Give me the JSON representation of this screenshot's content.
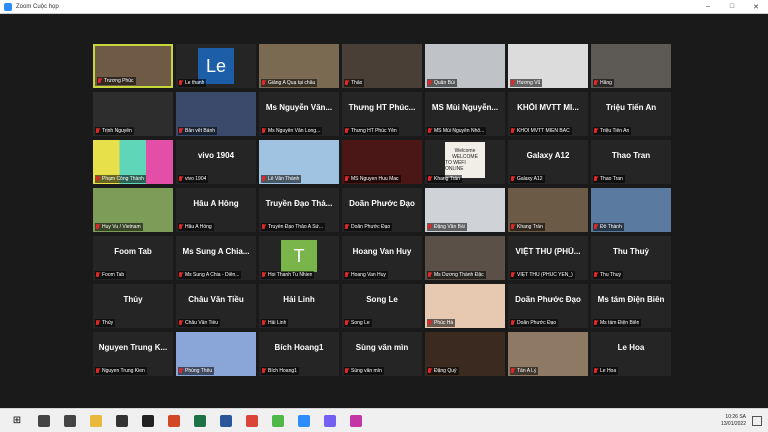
{
  "window": {
    "title": "Zoom Cuộc họp",
    "brand_color": "#2d8cff",
    "controls": [
      "minimize-icon",
      "maximize-icon",
      "close-icon"
    ]
  },
  "participants": [
    {
      "label": "Trương Phúc",
      "type": "video",
      "bg": "#6e5a45",
      "active": true
    },
    {
      "label": "Le thanh",
      "type": "avatar-le",
      "bg": "#ffffff"
    },
    {
      "label": "Giảng A Quạ tại châu",
      "type": "video",
      "bg": "#7a6a52"
    },
    {
      "label": "Thảo",
      "type": "video",
      "bg": "#4a3f36"
    },
    {
      "label": "Quân Bùi",
      "type": "video",
      "bg": "#bfc2c6"
    },
    {
      "label": "Hương Vũ",
      "type": "video",
      "bg": "#dcdcdc"
    },
    {
      "label": "Hằng",
      "type": "video",
      "bg": "#5d5a55"
    },
    {
      "label": "Trịnh Nguyễn",
      "type": "video",
      "bg": "#2d2d2d"
    },
    {
      "label": "Bản vẽt Bánh",
      "type": "video",
      "bg": "#3b4a6a"
    },
    {
      "name": "Ms Nguyễn Văn...",
      "label": "Ms Nguyễn Văn Long...",
      "type": "name"
    },
    {
      "name": "Thưng HT Phúc...",
      "label": "Thưng HT Phúc Yên",
      "type": "name"
    },
    {
      "name": "MS Mùi Nguyễn...",
      "label": "MS Mùi Nguyễn Nhô...",
      "type": "name"
    },
    {
      "name": "KHỐI MVTT MI...",
      "label": "KHỐI MVTT MIỀN BẮC",
      "type": "name"
    },
    {
      "name": "Triệu Tiến An",
      "label": "Triệu Tiến An",
      "type": "name"
    },
    {
      "label": "Phạm Công Thành",
      "type": "colors",
      "bg": "#e7e04a"
    },
    {
      "name": "vivo 1904",
      "label": "vivo 1904",
      "type": "name"
    },
    {
      "label": "Lê Văn Thành",
      "type": "video",
      "bg": "#9fc3e0"
    },
    {
      "label": "MS Nguyen Huu Mac",
      "type": "video",
      "bg": "#4a1616"
    },
    {
      "label": "Khang Trần",
      "type": "welcome",
      "bg": "#2a2a2a",
      "welcome_lines": [
        "Welcome",
        "WELCOME",
        "TO WEFI ONLINE"
      ]
    },
    {
      "name": "Galaxy A12",
      "label": "Galaxy A12",
      "type": "name"
    },
    {
      "name": "Thao Tran",
      "label": "Thao Tran",
      "type": "name"
    },
    {
      "label": "Huy Vu / Vietnam",
      "type": "video",
      "bg": "#7c9c58"
    },
    {
      "name": "Hâu A Hông",
      "label": "Hâu A Hồng",
      "type": "name"
    },
    {
      "name": "Truyền Đạo Thả...",
      "label": "Truyền Đạo Thảo A Sử...",
      "type": "name"
    },
    {
      "name": "Doãn Phước Đạo",
      "label": "Doãn Phước Đạo",
      "type": "name"
    },
    {
      "label": "Đặng Văn Bái",
      "type": "video",
      "bg": "#cfd3d8"
    },
    {
      "label": "Khang Trần",
      "type": "video",
      "bg": "#6a5a46"
    },
    {
      "label": "Đỗ Thành",
      "type": "video",
      "bg": "#5a7aa0"
    },
    {
      "name": "Foom Tab",
      "label": "Foom Tab",
      "type": "name"
    },
    {
      "name": "Ms Sung A Chia...",
      "label": "Ms Sung A Chia - Diên...",
      "type": "name"
    },
    {
      "label": "Hoi Thanh Tu Nhien",
      "type": "avatar-t",
      "bg": "#252525"
    },
    {
      "name": "Hoang Van Huy",
      "label": "Hoang Van Huy",
      "type": "name"
    },
    {
      "label": "Ms Dương Thành Đặc",
      "type": "video",
      "bg": "#5a5048"
    },
    {
      "name": "VIỆT THU (PHÚ...",
      "label": "VIỆT THU (PHÚC YÊN_)",
      "type": "name"
    },
    {
      "name": "Thu Thuỷ",
      "label": "Thu Thuỷ",
      "type": "name"
    },
    {
      "name": "Thủy",
      "label": "Thủy",
      "type": "name"
    },
    {
      "name": "Châu Văn Tiều",
      "label": "Châu Văn Tiều",
      "type": "name"
    },
    {
      "name": "Hải Linh",
      "label": "Hải Linh",
      "type": "name"
    },
    {
      "name": "Song Le",
      "label": "Song Le",
      "type": "name"
    },
    {
      "label": "Phúc Hà",
      "type": "video",
      "bg": "#e6c9b0"
    },
    {
      "name": "Doãn Phước Đạo",
      "label": "Doãn Phước Đạo",
      "type": "name"
    },
    {
      "name": "Ms tám Điện Biên",
      "label": "Ms tám Điện Biên",
      "type": "name"
    },
    {
      "name": "Nguyen Trung K...",
      "label": "Nguyen Trung Kien",
      "type": "name"
    },
    {
      "label": "Phùng Thêu",
      "type": "video",
      "bg": "#8aa6d8"
    },
    {
      "name": "Bích Hoang1",
      "label": "Bích Hoang1",
      "type": "name"
    },
    {
      "name": "Sùng văn mìn",
      "label": "Sùng văn mìn",
      "type": "name"
    },
    {
      "label": "Đặng Quý",
      "type": "video",
      "bg": "#3a2a20"
    },
    {
      "label": "Tấn A Lý",
      "type": "video",
      "bg": "#8e7a64"
    },
    {
      "name": "Le Hoa",
      "label": "Le Hoa",
      "type": "name"
    }
  ],
  "taskbar": {
    "start_icon": "windows-start-icon",
    "apps": [
      {
        "icon": "search-icon",
        "color": "#444444"
      },
      {
        "icon": "task-view-icon",
        "color": "#444444"
      },
      {
        "icon": "file-explorer-icon",
        "color": "#e8b93a"
      },
      {
        "icon": "obs-icon",
        "color": "#333333"
      },
      {
        "icon": "media-player-icon",
        "color": "#222222"
      },
      {
        "icon": "powerpoint-icon",
        "color": "#d24726"
      },
      {
        "icon": "excel-icon",
        "color": "#1e7145"
      },
      {
        "icon": "word-icon",
        "color": "#2b579a"
      },
      {
        "icon": "chrome-icon",
        "color": "#db4437"
      },
      {
        "icon": "camtasia-icon",
        "color": "#4fb848"
      },
      {
        "icon": "zoom-icon",
        "color": "#2d8cff"
      },
      {
        "icon": "viber-icon",
        "color": "#7360f2"
      },
      {
        "icon": "photos-icon",
        "color": "#c236a6"
      }
    ],
    "time": "10:26 SA",
    "date": "13/01/2022"
  }
}
